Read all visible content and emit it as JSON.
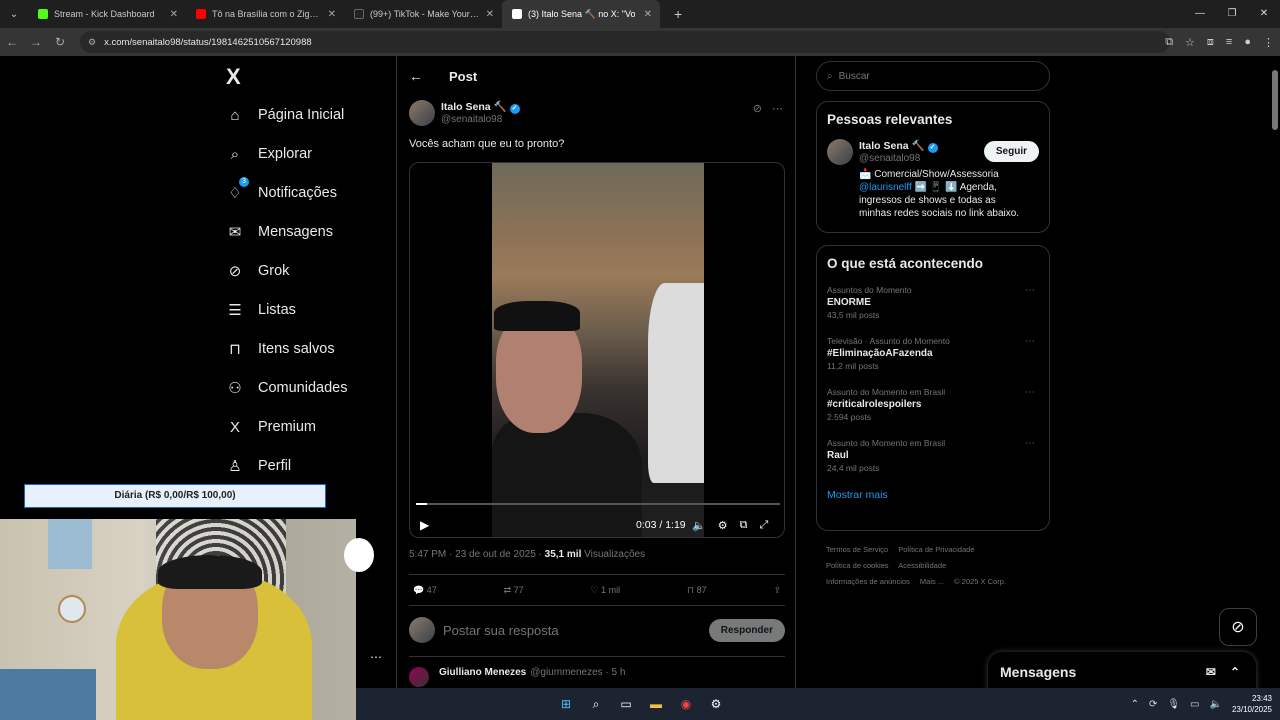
{
  "browser": {
    "tabs": [
      {
        "title": "Stream - Kick Dashboard",
        "fav_color": "#53fc18",
        "active": false
      },
      {
        "title": "Tô na Brasília com o Zigão - Yo",
        "fav_color": "#ff0000",
        "active": false
      },
      {
        "title": "(99+) TikTok - Make Your Day",
        "fav_color": "#222222",
        "active": false
      },
      {
        "title": "(3) Italo Sena 🔨 no X: \"Vo",
        "fav_color": "#ffffff",
        "active": true
      }
    ],
    "new_tab_glyph": "+",
    "url": "x.com/senaitalo98/status/1981462510567120988"
  },
  "sidebar": {
    "logo": "X",
    "items": [
      {
        "label": "Página Inicial",
        "icon": "home-icon",
        "glyph": "⌂"
      },
      {
        "label": "Explorar",
        "icon": "search-icon",
        "glyph": "⌕"
      },
      {
        "label": "Notificações",
        "icon": "bell-icon",
        "glyph": "🔔",
        "badge": "3"
      },
      {
        "label": "Mensagens",
        "icon": "mail-icon",
        "glyph": "✉"
      },
      {
        "label": "Grok",
        "icon": "grok-icon",
        "glyph": "⊘"
      },
      {
        "label": "Listas",
        "icon": "list-icon",
        "glyph": "☰"
      },
      {
        "label": "Itens salvos",
        "icon": "bookmark-icon",
        "glyph": "🔖"
      },
      {
        "label": "Comunidades",
        "icon": "people-icon",
        "glyph": "👥"
      },
      {
        "label": "Premium",
        "icon": "x-premium-icon",
        "glyph": "X"
      },
      {
        "label": "Perfil",
        "icon": "person-icon",
        "glyph": "👤"
      }
    ]
  },
  "post": {
    "header_title": "Post",
    "author_name": "Italo Sena 🔨",
    "author_handle": "@senaitalo98",
    "text": "Vocês acham que eu to pronto?",
    "video": {
      "time": "0:03 / 1:19",
      "progress": 0.03
    },
    "meta_time": "5:47 PM · 23 de out de 2025 · ",
    "views_count": "35,1 mil",
    "views_label": " Visualizações",
    "stats": {
      "replies": "47",
      "reposts": "77",
      "likes": "1 mil",
      "bookmarks": "87"
    },
    "reply_placeholder": "Postar sua resposta",
    "reply_button": "Responder",
    "reply": {
      "name": "Giulliano Menezes",
      "handle": "@giummenezes · 5 h"
    }
  },
  "right": {
    "search_placeholder": "Buscar",
    "relevant_title": "Pessoas relevantes",
    "relevant_person": {
      "name": "Italo Sena 🔨",
      "handle": "@senaitalo98",
      "follow_label": "Seguir",
      "bio_prefix": "📩 Comercial/Show/Assessoria ",
      "bio_link": "@laurisnelff",
      "bio_suffix": " ➡️ 📱 ⬇️ Agenda, ingressos de shows e todas as minhas redes sociais no link abaixo."
    },
    "trending_title": "O que está acontecendo",
    "trends": [
      {
        "context": "Assuntos do Momento",
        "name": "ENORME",
        "count": "43,5 mil posts"
      },
      {
        "context": "Televisão · Assunto do Momento",
        "name": "#EliminaçãoAFazenda",
        "count": "11,2 mil posts"
      },
      {
        "context": "Assunto do Momento em Brasil",
        "name": "#criticalrolespoilers",
        "count": "2.594 posts"
      },
      {
        "context": "Assunto do Momento em Brasil",
        "name": "Raul",
        "count": "24,4 mil posts"
      }
    ],
    "show_more": "Mostrar mais",
    "footer_links": [
      "Termos de Serviço",
      "Política de Privacidade",
      "Política de cookies",
      "Acessibilidade",
      "Informações de anúncios",
      "Mais ...",
      "© 2025 X Corp."
    ],
    "messages_drawer": "Mensagens"
  },
  "overlay": {
    "goal_text": "Diária (R$ 0,00/R$ 100,00)"
  },
  "taskbar": {
    "time": "23:43",
    "date": "23/10/2025"
  }
}
